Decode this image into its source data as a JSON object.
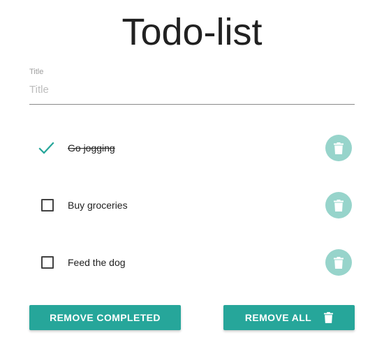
{
  "header": {
    "title": "Todo-list"
  },
  "form": {
    "label": "Title",
    "placeholder": "Title",
    "value": ""
  },
  "todos": [
    {
      "text": "Go jogging",
      "completed": true
    },
    {
      "text": "Buy groceries",
      "completed": false
    },
    {
      "text": "Feed the dog",
      "completed": false
    }
  ],
  "actions": {
    "remove_completed_label": "REMOVE COMPLETED",
    "remove_all_label": "REMOVE ALL"
  },
  "colors": {
    "accent": "#26a69a",
    "delete_button": "#97d4cb",
    "text": "#212121"
  },
  "icons": {
    "completed": "checkmark-icon",
    "incomplete": "checkbox-icon",
    "delete": "trash-icon"
  }
}
